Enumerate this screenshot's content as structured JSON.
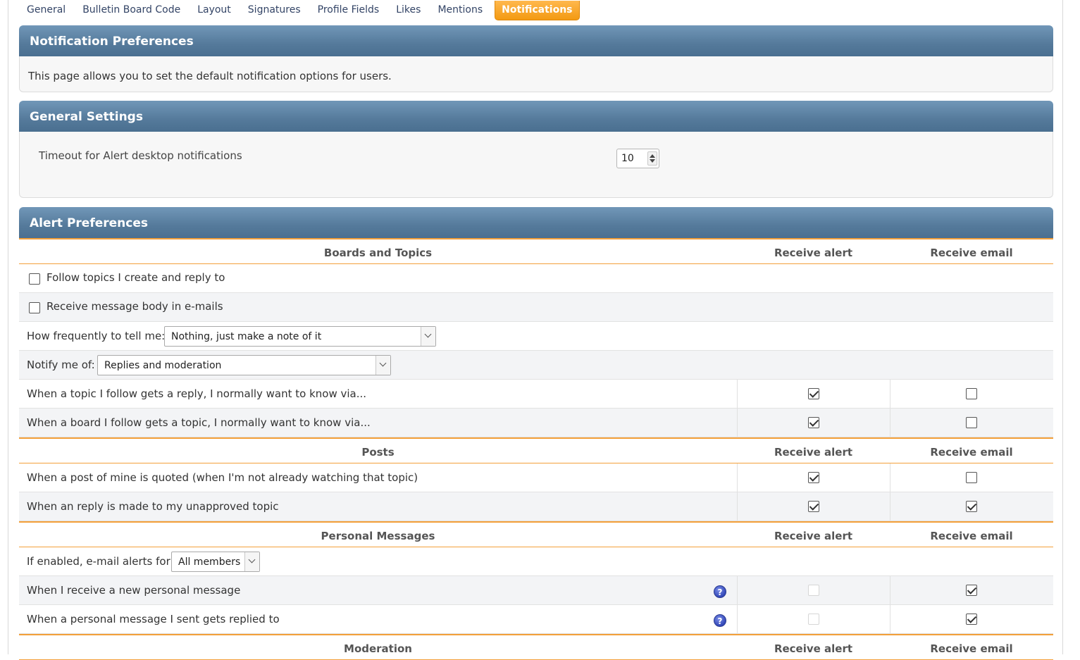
{
  "tabs": [
    "General",
    "Bulletin Board Code",
    "Layout",
    "Signatures",
    "Profile Fields",
    "Likes",
    "Mentions",
    "Notifications"
  ],
  "active_tab": "Notifications",
  "notification_preferences": {
    "title": "Notification Preferences",
    "description": "This page allows you to set the default notification options for users."
  },
  "general_settings": {
    "title": "General Settings",
    "timeout_label": "Timeout for Alert desktop notifications",
    "timeout_value": "10"
  },
  "alert_preferences": {
    "title": "Alert Preferences",
    "col_alert": "Receive alert",
    "col_email": "Receive email",
    "boards": {
      "header": "Boards and Topics",
      "follow_topics": "Follow topics I create and reply to",
      "message_body": "Receive message body in e-mails",
      "frequency_label": "How frequently to tell me:",
      "frequency_value": "Nothing, just make a note of it",
      "notify_label": "Notify me of:",
      "notify_value": "Replies and moderation",
      "topic_reply": "When a topic I follow gets a reply, I normally want to know via...",
      "board_topic": "When a board I follow gets a topic, I normally want to know via..."
    },
    "posts": {
      "header": "Posts",
      "quoted": "When a post of mine is quoted (when I'm not already watching that topic)",
      "unapproved_reply": "When an reply is made to my unapproved topic"
    },
    "pm": {
      "header": "Personal Messages",
      "email_alerts_label": "If enabled, e-mail alerts for:",
      "email_alerts_value": "All members",
      "new_pm": "When I receive a new personal message",
      "pm_replied": "When a personal message I sent gets replied to"
    },
    "moderation": {
      "header": "Moderation"
    }
  }
}
